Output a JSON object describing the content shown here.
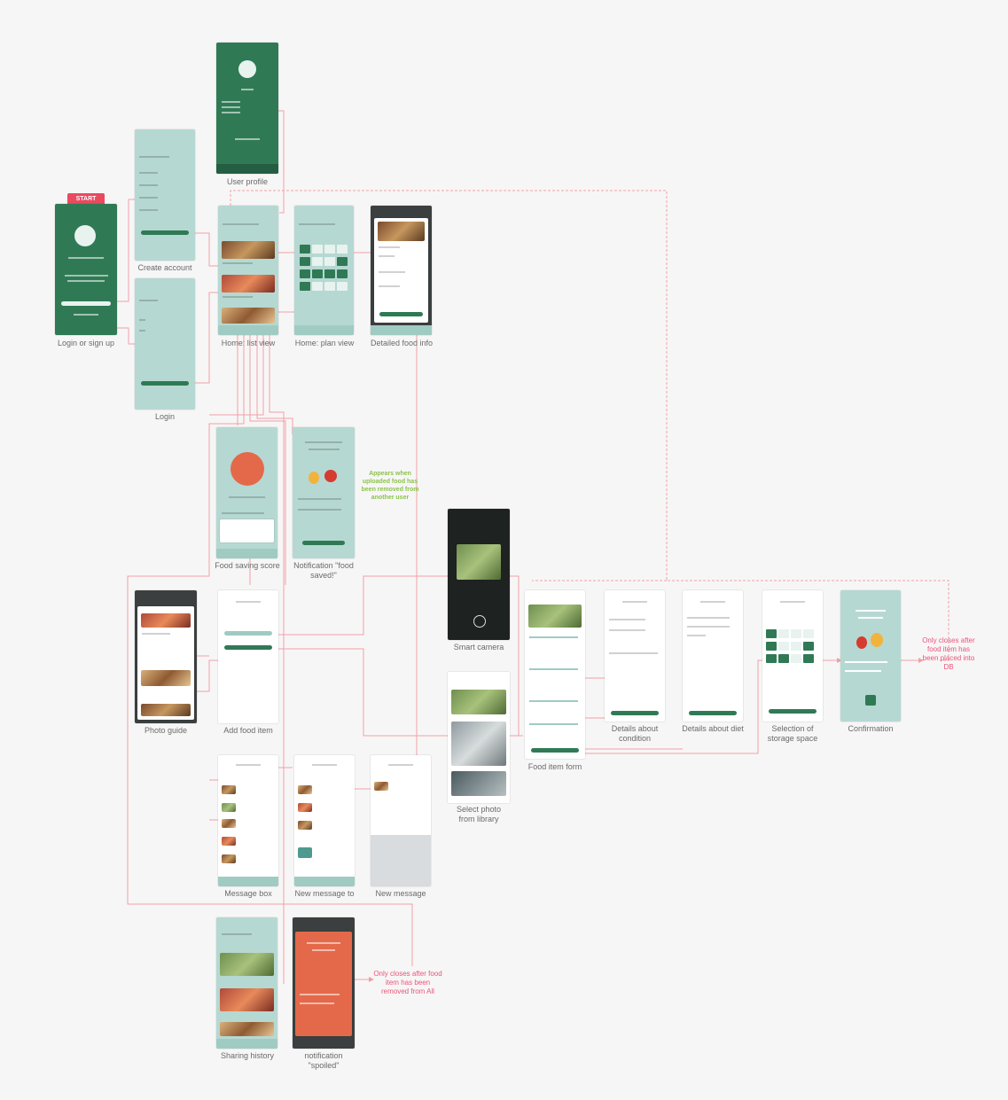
{
  "start_badge": "START",
  "screens": {
    "login_or_signup": "Login or sign up",
    "create_account": "Create account",
    "login": "Login",
    "user_profile": "User profile",
    "home_list": "Home: list view",
    "home_plan": "Home: plan view",
    "detailed_food": "Detailed food info",
    "food_saving_score": "Food saving score",
    "notification_saved": "Notification \"food saved!\"",
    "photo_guide": "Photo guide",
    "add_food_item": "Add food item",
    "smart_camera": "Smart camera",
    "select_photo": "Select photo from library",
    "food_item_form": "Food item form",
    "details_condition": "Details about condition",
    "details_diet": "Details about diet",
    "selection_storage": "Selection of storage space",
    "confirmation": "Confirmation",
    "message_box": "Message box",
    "new_message_to": "New message to",
    "new_message": "New message",
    "sharing_history": "Sharing history",
    "notification_spoiled": "notification \"spoiled\""
  },
  "notes": {
    "appears_when": "Appears when uploaded food has been removed from another user",
    "only_closes_db": "Only closes after food item has been placed into DB",
    "only_closes_removed": "Only closes after food item has been removed from All"
  },
  "colors": {
    "teal": "#b6d8d2",
    "brand_green": "#2f7a55",
    "flow_line": "#f0a0a8",
    "note_red": "#e9557a",
    "note_green": "#8bc34a"
  }
}
